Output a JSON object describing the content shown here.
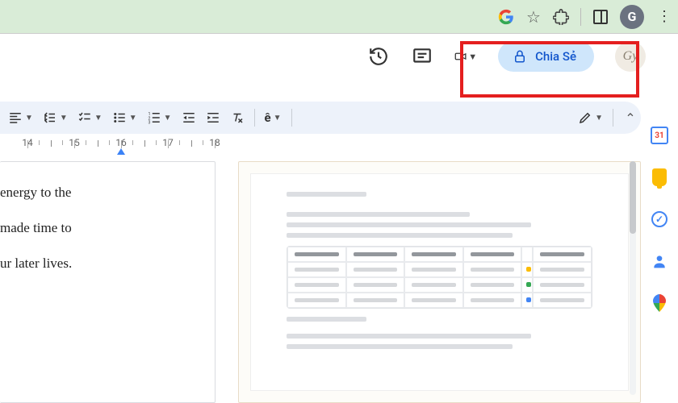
{
  "browser": {
    "extensions": [
      "google",
      "favorite",
      "extensions",
      "reader",
      "grammarly",
      "menu"
    ]
  },
  "header": {
    "share_label": "Chia Sẻ",
    "avatar_initial": "Gy"
  },
  "toolbar": {
    "format_char": "ê",
    "calendar_day": "31"
  },
  "ruler": {
    "labels": [
      "14",
      "15",
      "16",
      "17",
      "18"
    ]
  },
  "document": {
    "page1_line1": "energy to the",
    "page1_line2": " made time to",
    "page1_line3": "ur later lives."
  }
}
